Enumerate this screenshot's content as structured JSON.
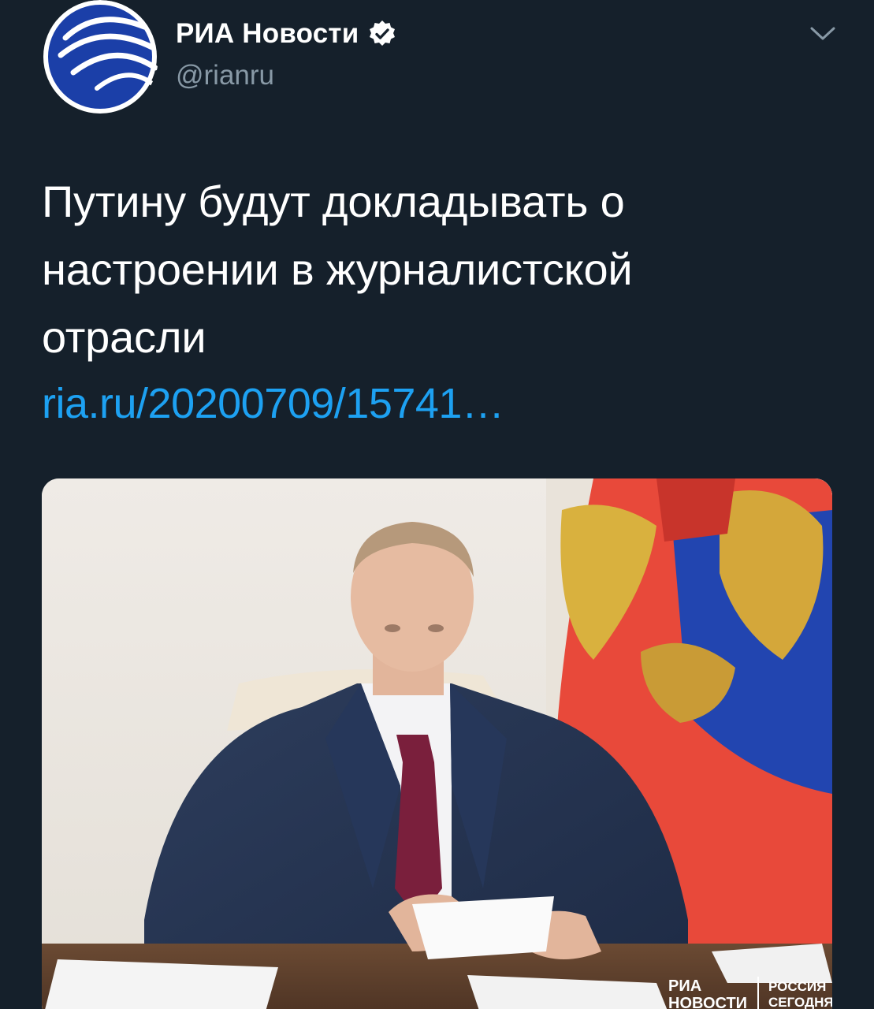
{
  "header": {
    "display_name": "РИА Новости",
    "handle": "@rianru",
    "avatar_icon": "ria-novosti-logo-icon",
    "verified_icon": "verified-badge-icon",
    "menu_icon": "chevron-down-icon"
  },
  "tweet": {
    "text_lines": [
      "Путину будут докладывать о",
      "настроении в журналистской",
      "отрасли"
    ],
    "link": "ria.ru/20200709/15741…"
  },
  "media": {
    "watermark_left_1": "РИА",
    "watermark_left_2": "НОВОСТИ",
    "watermark_right_1": "РОССИЯ",
    "watermark_right_2": "СЕГОДНЯ"
  },
  "colors": {
    "background": "#15202b",
    "text": "#ffffff",
    "secondary": "#8899a6",
    "link": "#1da1f2",
    "avatar_blue": "#1b3fa8"
  }
}
